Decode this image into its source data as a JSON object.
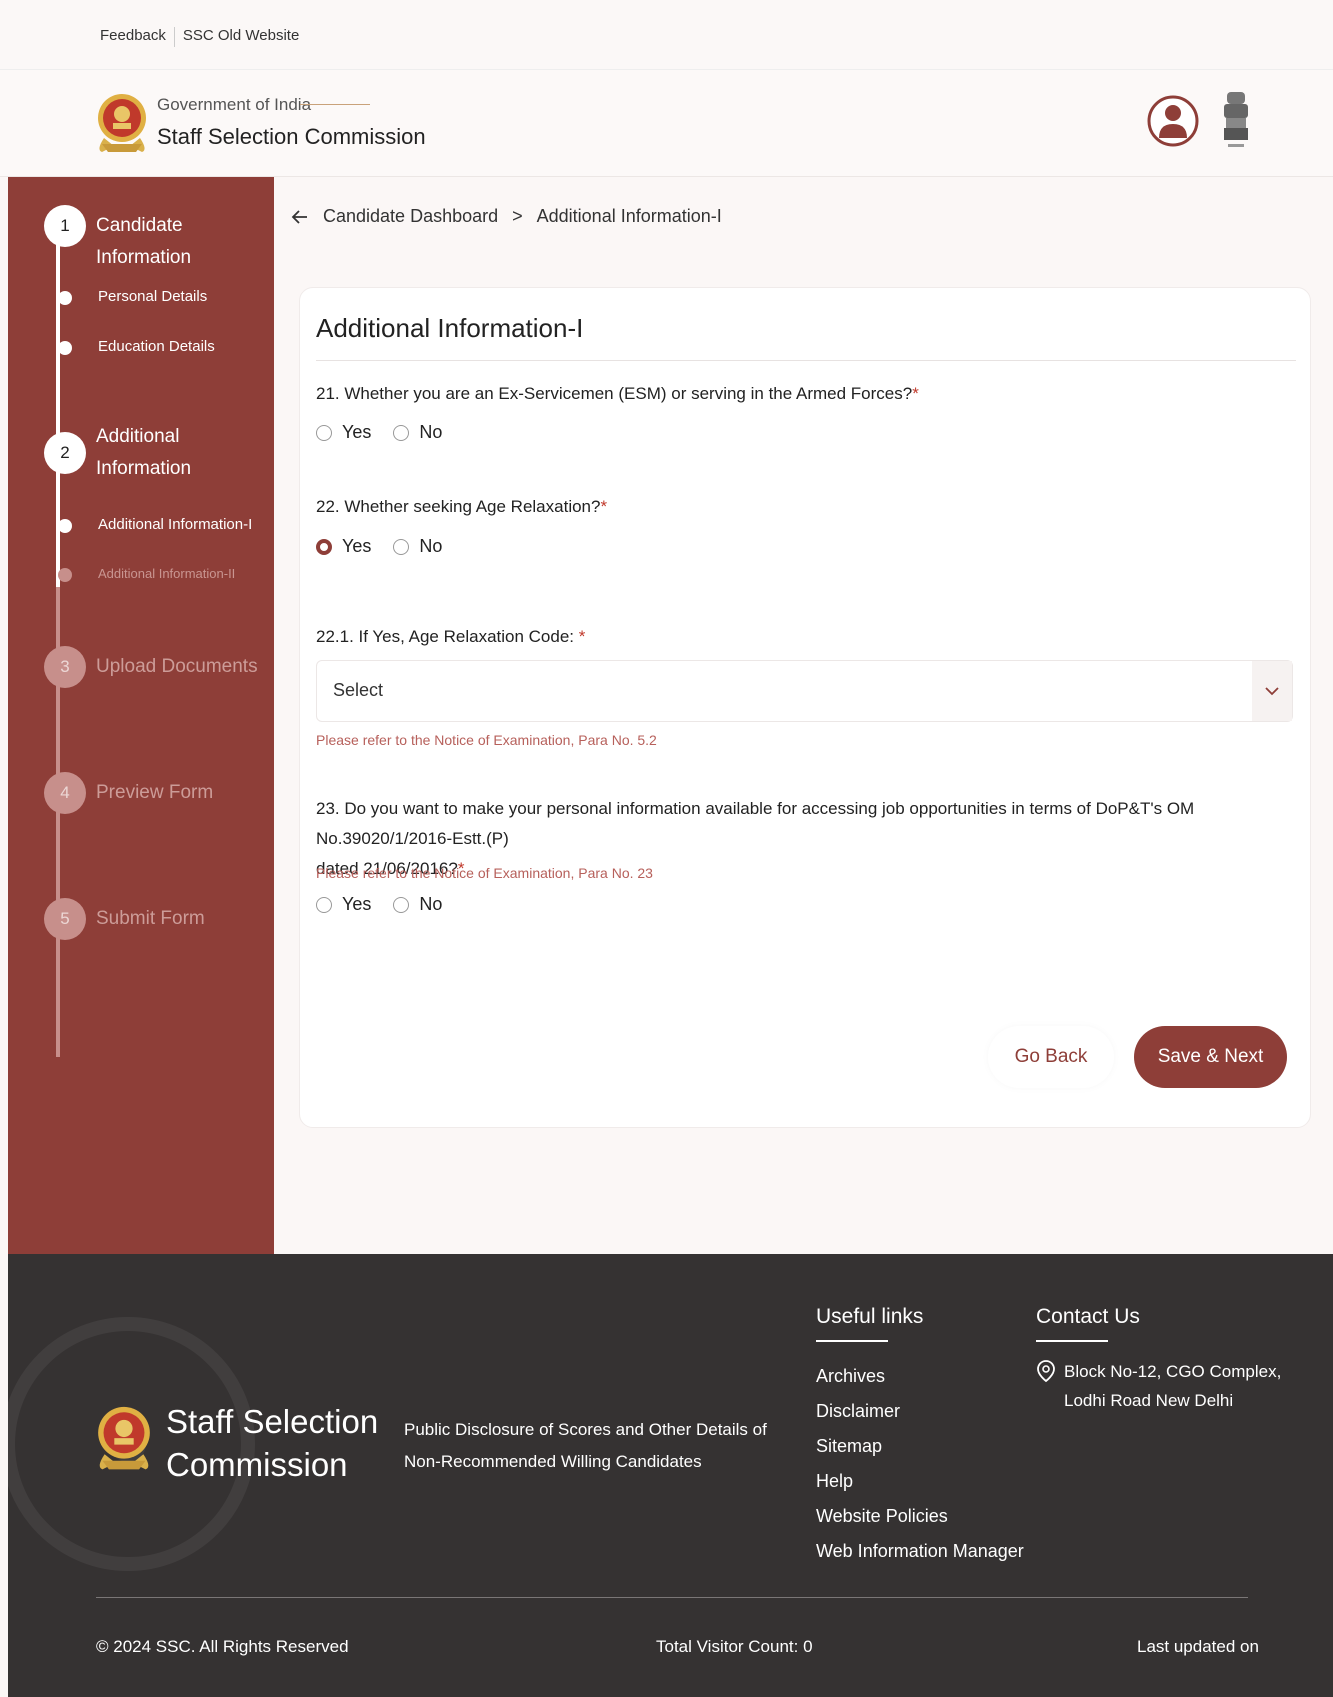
{
  "topbar": {
    "feedback": "Feedback",
    "old_site": "SSC Old Website"
  },
  "header": {
    "gov": "Government of India",
    "org": "Staff Selection Commission"
  },
  "sidebar": {
    "steps": [
      {
        "num": "1",
        "label": "Candidate Information"
      },
      {
        "num": "2",
        "label": "Additional Information"
      },
      {
        "num": "3",
        "label": "Upload Documents"
      },
      {
        "num": "4",
        "label": "Preview Form"
      },
      {
        "num": "5",
        "label": "Submit Form"
      }
    ],
    "subitems": [
      "Personal Details",
      "Education Details",
      "Additional Information-I",
      "Additional Information-II"
    ]
  },
  "breadcrumb": {
    "home": "Candidate Dashboard",
    "sep": ">",
    "current": "Additional Information-I"
  },
  "form": {
    "title": "Additional Information-I",
    "q21": "21. Whether you are an Ex-Servicemen (ESM) or serving in the Armed Forces?",
    "q22": "22. Whether seeking Age Relaxation?",
    "q22_1": "22.1. If Yes, Age Relaxation Code: ",
    "q23_line1": "23. Do you want to make your personal information available for accessing job opportunities in terms of DoP&T's OM No.39020/1/2016-Estt.(P)",
    "q23_line2": "dated 21/06/2016?",
    "required_mark": "*",
    "yes": "Yes",
    "no": "No",
    "q21_selected": "",
    "q22_selected": "Yes",
    "q23_selected": "",
    "select_value": "Select",
    "hint_22_1": "Please refer to the Notice of Examination, Para No. 5.2",
    "hint_23": "Please refer to the Notice of Examination, Para No. 23",
    "go_back": "Go Back",
    "save_next": "Save & Next"
  },
  "footer": {
    "org_line1": "Staff Selection",
    "org_line2": "Commission",
    "public_disclosure": "Public Disclosure of Scores and Other Details of Non-Recommended Willing Candidates",
    "useful_links_title": "Useful links",
    "useful_links": [
      "Archives",
      "Disclaimer",
      "Sitemap",
      "Help",
      "Website Policies",
      "Web Information Manager"
    ],
    "contact_title": "Contact Us",
    "address_line1": "Block No-12, CGO Complex,",
    "address_line2": "Lodhi Road New Delhi",
    "copyright": "© 2024 SSC. All Rights Reserved",
    "visitor_count": "Total Visitor Count: 0",
    "last_updated": "Last updated on"
  },
  "colors": {
    "brand": "#8e3e38",
    "footer_bg": "#353232",
    "hint": "#b7605b"
  }
}
